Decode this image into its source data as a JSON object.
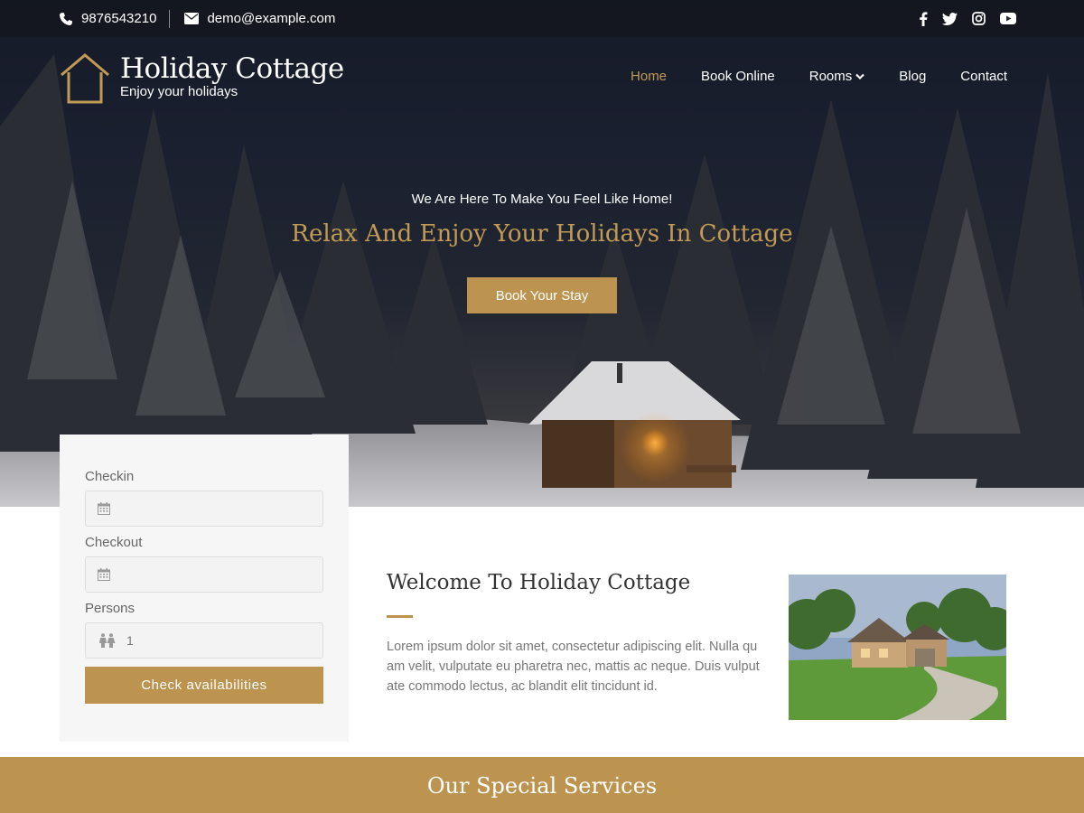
{
  "topbar": {
    "phone": "9876543210",
    "email": "demo@example.com",
    "social": [
      "facebook-icon",
      "twitter-icon",
      "instagram-icon",
      "youtube-icon"
    ]
  },
  "brand": {
    "title": "Holiday Cottage",
    "tagline": "Enjoy your holidays"
  },
  "nav": {
    "items": [
      "Home",
      "Book Online",
      "Rooms",
      "Blog",
      "Contact"
    ],
    "active": "Home"
  },
  "hero": {
    "subtitle": "We Are Here To Make You Feel Like Home!",
    "title": "Relax And Enjoy Your Holidays In Cottage",
    "button": "Book Your Stay"
  },
  "booking": {
    "checkin_label": "Checkin",
    "checkin_value": "",
    "checkout_label": "Checkout",
    "checkout_value": "",
    "persons_label": "Persons",
    "persons_value": "1",
    "button": "Check availabilities"
  },
  "welcome": {
    "title": "Welcome To Holiday Cottage",
    "text": "Lorem ipsum dolor sit amet, consectetur adipiscing elit. Nulla quam velit, vulputate eu pharetra nec, mattis ac neque. Duis vulputate commodo lectus, ac blandit elit tincidunt id."
  },
  "services": {
    "title": "Our Special Services"
  },
  "colors": {
    "accent": "#bc9450",
    "topbar": "#14161c"
  }
}
